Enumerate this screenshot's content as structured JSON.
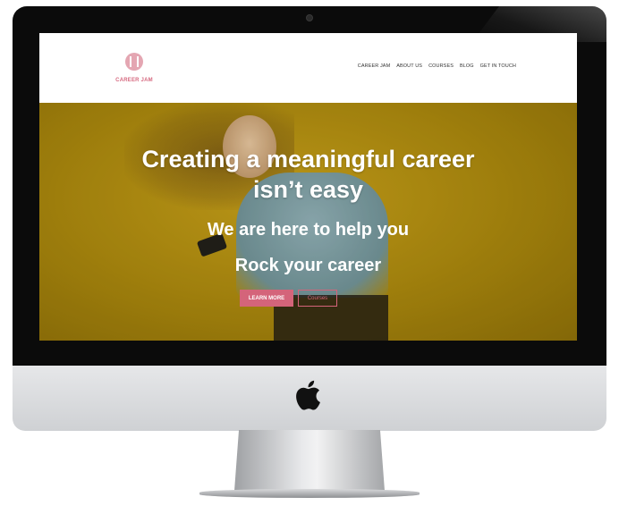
{
  "site": {
    "logo_text": "CAREER JAM",
    "nav": [
      "CAREER JAM",
      "ABOUT US",
      "COURSES",
      "BLOG",
      "GET IN TOUCH"
    ],
    "accent_color": "#d4647a",
    "hero_bg_color": "#b58e0f"
  },
  "hero": {
    "title_line1": "Creating a meaningful career",
    "title_line2": "isn’t easy",
    "subtitle_line1": "We are here to help you",
    "subtitle_line2": "Rock your career",
    "primary_button": "LEARN MORE",
    "secondary_button": "Courses"
  },
  "device": {
    "logo_icon": "apple-icon",
    "camera_icon": "camera-icon"
  }
}
